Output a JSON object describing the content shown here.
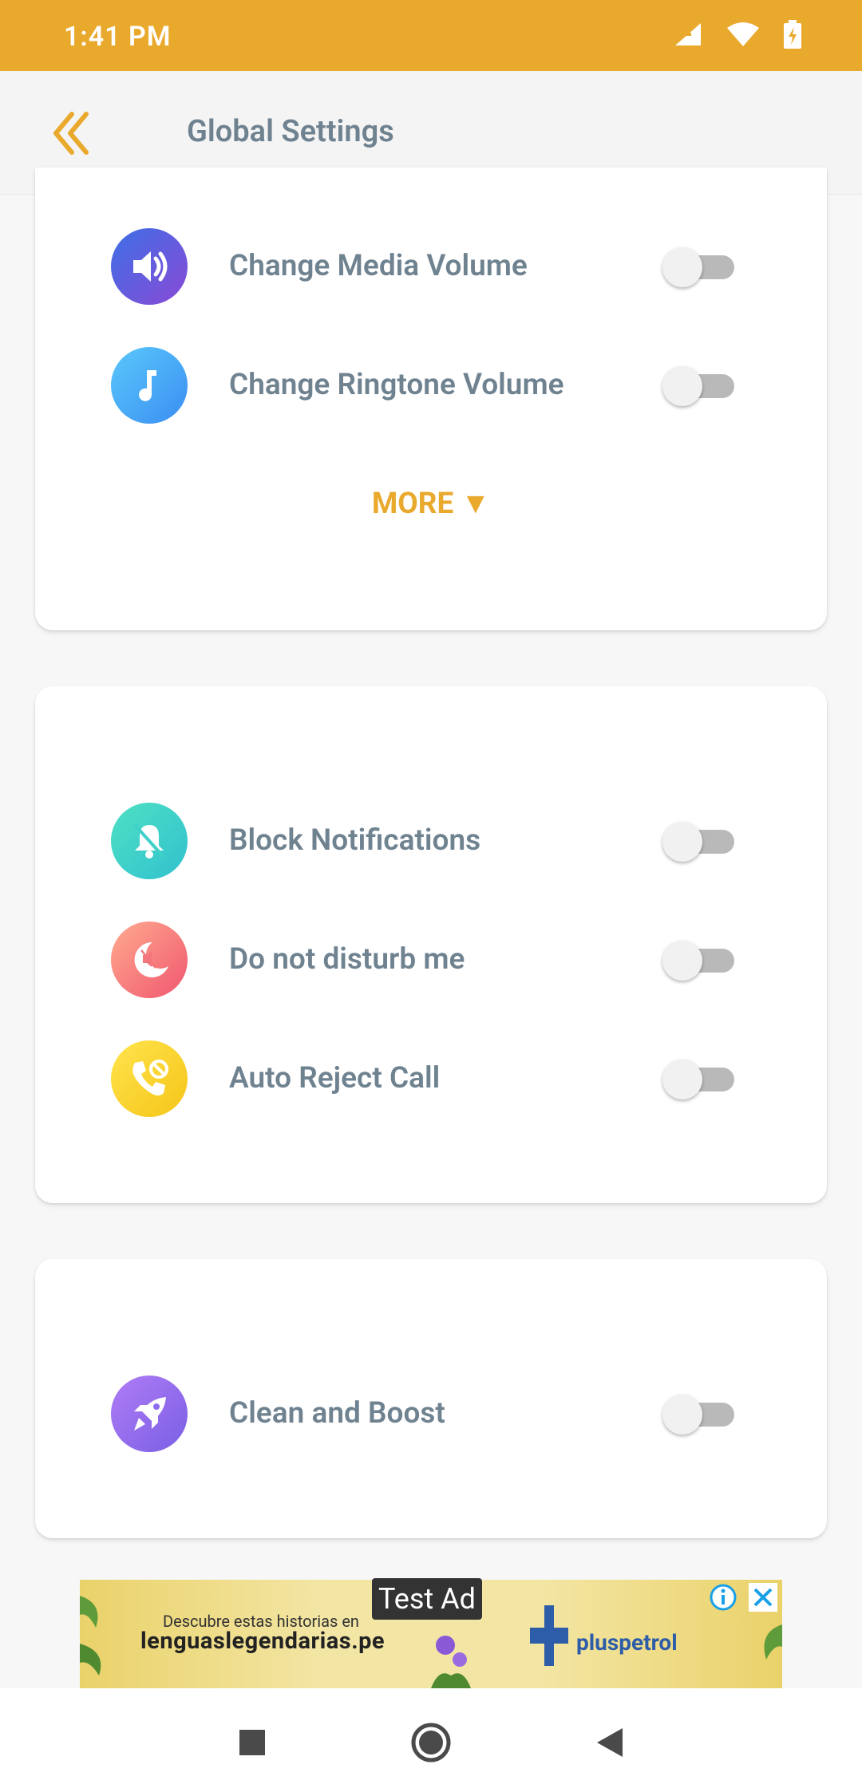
{
  "status_bar": {
    "time": "1:41 PM"
  },
  "app_bar": {
    "title": "Global Settings"
  },
  "colors": {
    "accent": "#e9a92c",
    "label": "#6f8290"
  },
  "card1": {
    "items": [
      {
        "label": "Change Media Volume",
        "icon": "speaker-icon",
        "enabled": false
      },
      {
        "label": "Change Ringtone Volume",
        "icon": "music-note-icon",
        "enabled": false
      }
    ],
    "more_label": "MORE ▼"
  },
  "card2": {
    "items": [
      {
        "label": "Block Notifications",
        "icon": "bell-off-icon",
        "enabled": false
      },
      {
        "label": "Do not disturb me",
        "icon": "moon-mute-icon",
        "enabled": false
      },
      {
        "label": "Auto Reject Call",
        "icon": "phone-block-icon",
        "enabled": false
      }
    ]
  },
  "card3": {
    "items": [
      {
        "label": "Clean and Boost",
        "icon": "rocket-icon",
        "enabled": false
      }
    ]
  },
  "ad": {
    "label": "Test Ad",
    "line1": "Descubre estas historias en",
    "line2": "lenguaslegendarias.pe",
    "brand": "pluspetrol"
  }
}
